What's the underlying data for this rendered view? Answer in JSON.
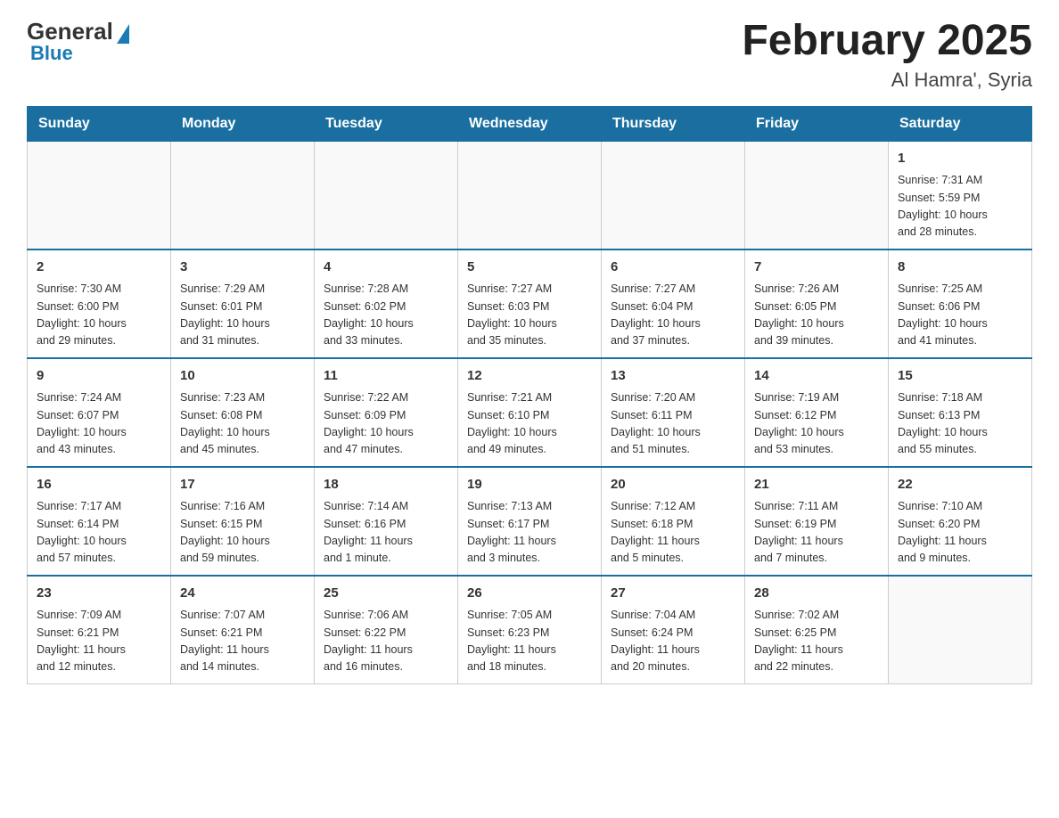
{
  "header": {
    "logo": {
      "general": "General",
      "blue": "Blue"
    },
    "title": "February 2025",
    "location": "Al Hamra', Syria"
  },
  "weekdays": [
    "Sunday",
    "Monday",
    "Tuesday",
    "Wednesday",
    "Thursday",
    "Friday",
    "Saturday"
  ],
  "weeks": [
    [
      {
        "day": "",
        "info": ""
      },
      {
        "day": "",
        "info": ""
      },
      {
        "day": "",
        "info": ""
      },
      {
        "day": "",
        "info": ""
      },
      {
        "day": "",
        "info": ""
      },
      {
        "day": "",
        "info": ""
      },
      {
        "day": "1",
        "info": "Sunrise: 7:31 AM\nSunset: 5:59 PM\nDaylight: 10 hours\nand 28 minutes."
      }
    ],
    [
      {
        "day": "2",
        "info": "Sunrise: 7:30 AM\nSunset: 6:00 PM\nDaylight: 10 hours\nand 29 minutes."
      },
      {
        "day": "3",
        "info": "Sunrise: 7:29 AM\nSunset: 6:01 PM\nDaylight: 10 hours\nand 31 minutes."
      },
      {
        "day": "4",
        "info": "Sunrise: 7:28 AM\nSunset: 6:02 PM\nDaylight: 10 hours\nand 33 minutes."
      },
      {
        "day": "5",
        "info": "Sunrise: 7:27 AM\nSunset: 6:03 PM\nDaylight: 10 hours\nand 35 minutes."
      },
      {
        "day": "6",
        "info": "Sunrise: 7:27 AM\nSunset: 6:04 PM\nDaylight: 10 hours\nand 37 minutes."
      },
      {
        "day": "7",
        "info": "Sunrise: 7:26 AM\nSunset: 6:05 PM\nDaylight: 10 hours\nand 39 minutes."
      },
      {
        "day": "8",
        "info": "Sunrise: 7:25 AM\nSunset: 6:06 PM\nDaylight: 10 hours\nand 41 minutes."
      }
    ],
    [
      {
        "day": "9",
        "info": "Sunrise: 7:24 AM\nSunset: 6:07 PM\nDaylight: 10 hours\nand 43 minutes."
      },
      {
        "day": "10",
        "info": "Sunrise: 7:23 AM\nSunset: 6:08 PM\nDaylight: 10 hours\nand 45 minutes."
      },
      {
        "day": "11",
        "info": "Sunrise: 7:22 AM\nSunset: 6:09 PM\nDaylight: 10 hours\nand 47 minutes."
      },
      {
        "day": "12",
        "info": "Sunrise: 7:21 AM\nSunset: 6:10 PM\nDaylight: 10 hours\nand 49 minutes."
      },
      {
        "day": "13",
        "info": "Sunrise: 7:20 AM\nSunset: 6:11 PM\nDaylight: 10 hours\nand 51 minutes."
      },
      {
        "day": "14",
        "info": "Sunrise: 7:19 AM\nSunset: 6:12 PM\nDaylight: 10 hours\nand 53 minutes."
      },
      {
        "day": "15",
        "info": "Sunrise: 7:18 AM\nSunset: 6:13 PM\nDaylight: 10 hours\nand 55 minutes."
      }
    ],
    [
      {
        "day": "16",
        "info": "Sunrise: 7:17 AM\nSunset: 6:14 PM\nDaylight: 10 hours\nand 57 minutes."
      },
      {
        "day": "17",
        "info": "Sunrise: 7:16 AM\nSunset: 6:15 PM\nDaylight: 10 hours\nand 59 minutes."
      },
      {
        "day": "18",
        "info": "Sunrise: 7:14 AM\nSunset: 6:16 PM\nDaylight: 11 hours\nand 1 minute."
      },
      {
        "day": "19",
        "info": "Sunrise: 7:13 AM\nSunset: 6:17 PM\nDaylight: 11 hours\nand 3 minutes."
      },
      {
        "day": "20",
        "info": "Sunrise: 7:12 AM\nSunset: 6:18 PM\nDaylight: 11 hours\nand 5 minutes."
      },
      {
        "day": "21",
        "info": "Sunrise: 7:11 AM\nSunset: 6:19 PM\nDaylight: 11 hours\nand 7 minutes."
      },
      {
        "day": "22",
        "info": "Sunrise: 7:10 AM\nSunset: 6:20 PM\nDaylight: 11 hours\nand 9 minutes."
      }
    ],
    [
      {
        "day": "23",
        "info": "Sunrise: 7:09 AM\nSunset: 6:21 PM\nDaylight: 11 hours\nand 12 minutes."
      },
      {
        "day": "24",
        "info": "Sunrise: 7:07 AM\nSunset: 6:21 PM\nDaylight: 11 hours\nand 14 minutes."
      },
      {
        "day": "25",
        "info": "Sunrise: 7:06 AM\nSunset: 6:22 PM\nDaylight: 11 hours\nand 16 minutes."
      },
      {
        "day": "26",
        "info": "Sunrise: 7:05 AM\nSunset: 6:23 PM\nDaylight: 11 hours\nand 18 minutes."
      },
      {
        "day": "27",
        "info": "Sunrise: 7:04 AM\nSunset: 6:24 PM\nDaylight: 11 hours\nand 20 minutes."
      },
      {
        "day": "28",
        "info": "Sunrise: 7:02 AM\nSunset: 6:25 PM\nDaylight: 11 hours\nand 22 minutes."
      },
      {
        "day": "",
        "info": ""
      }
    ]
  ]
}
